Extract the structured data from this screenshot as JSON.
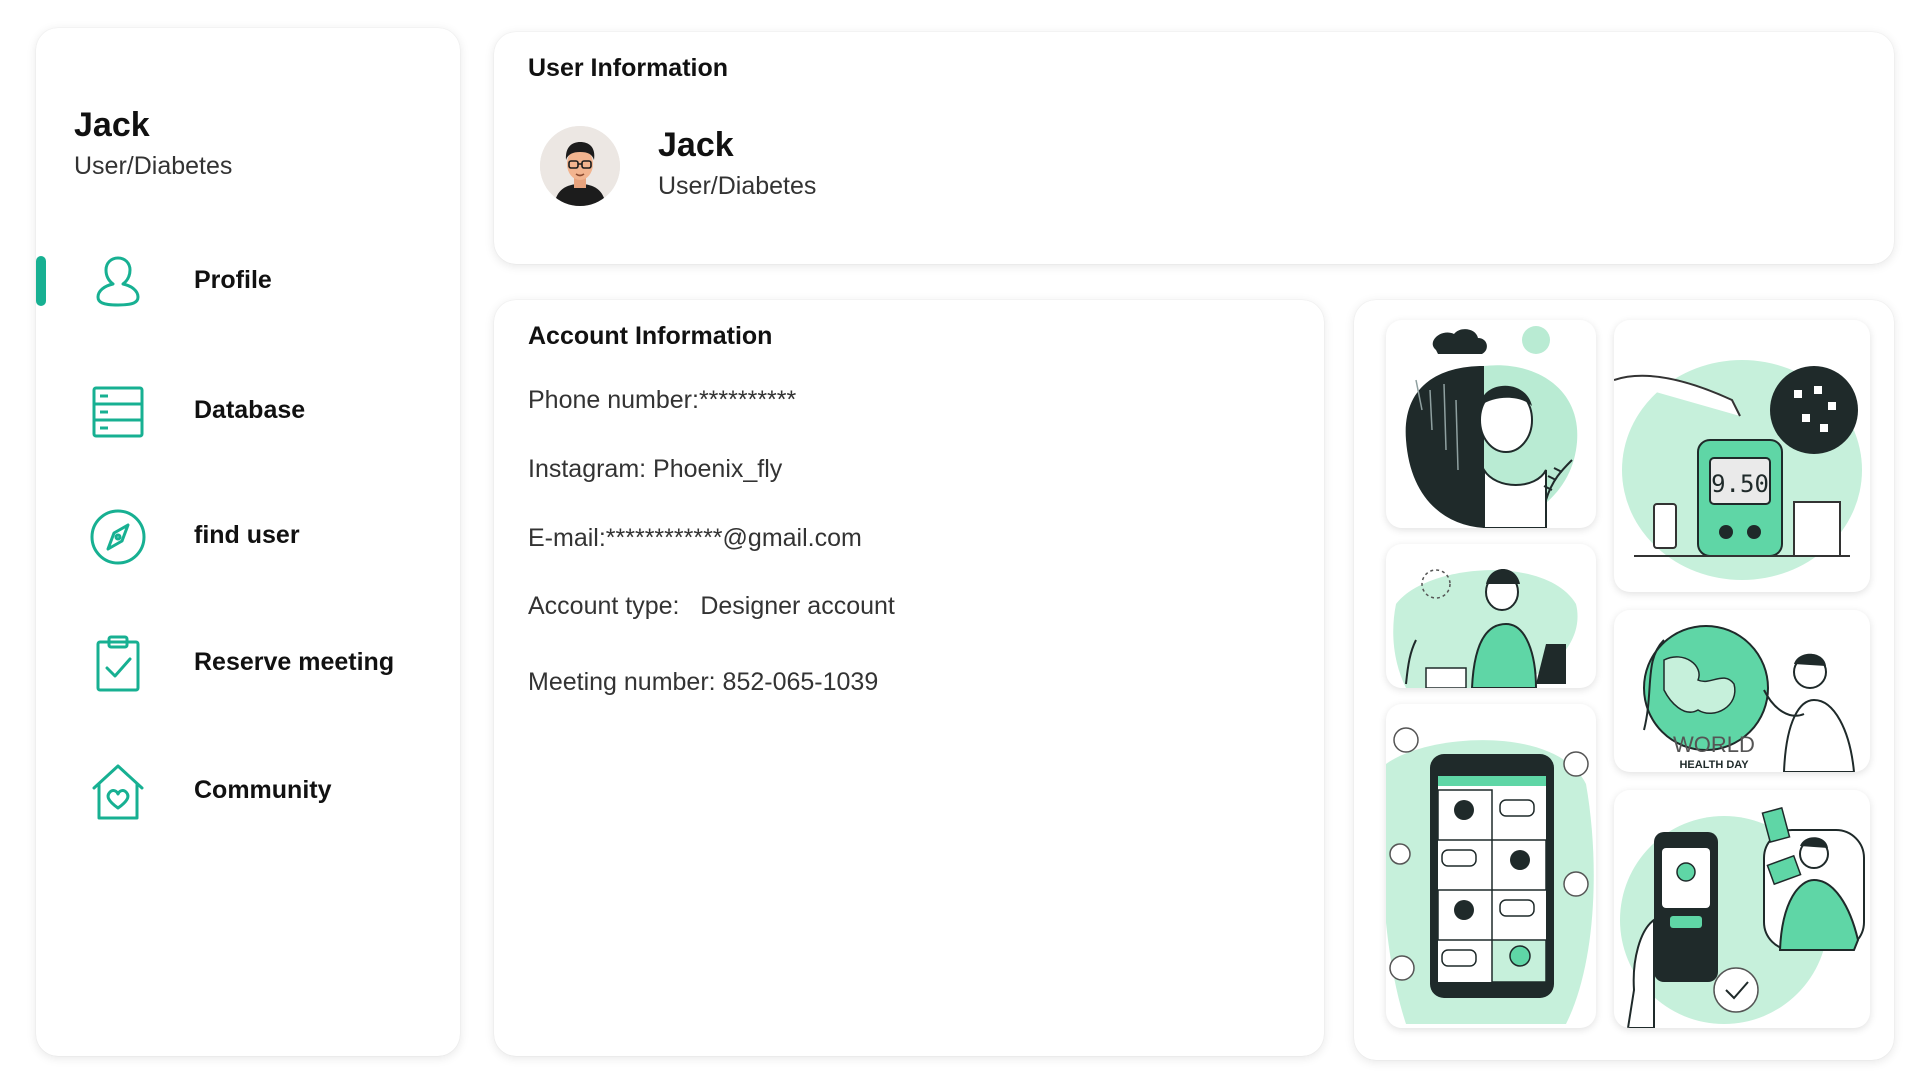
{
  "sidebar": {
    "user_name": "Jack",
    "user_role": "User/Diabetes",
    "active_item": "Profile",
    "accent_color": "#17b092",
    "items": [
      {
        "label": "Profile",
        "icon": "user-icon"
      },
      {
        "label": "Database",
        "icon": "database-icon"
      },
      {
        "label": "find user",
        "icon": "compass-icon"
      },
      {
        "label": "Reserve meeting",
        "icon": "clipboard-check-icon"
      },
      {
        "label": "Community",
        "icon": "house-heart-icon"
      }
    ]
  },
  "user_info": {
    "title": "User Information",
    "name": "Jack",
    "role": "User/Diabetes"
  },
  "account_info": {
    "title": "Account Information",
    "rows": [
      "Phone number:**********",
      "Instagram: Phoenix_fly",
      "E-mail:************@gmail.com",
      "Account type:   Designer account",
      "Meeting number: 852-065-1039"
    ]
  },
  "gallery": {
    "tiles": [
      {
        "icon": "mental-health-illustration"
      },
      {
        "icon": "glucose-meter-illustration",
        "text": "9.50"
      },
      {
        "icon": "lab-scientist-illustration"
      },
      {
        "icon": "world-health-day-illustration",
        "text": [
          "WORLD",
          "HEALTH DAY"
        ]
      },
      {
        "icon": "video-chat-illustration"
      },
      {
        "icon": "mobile-payment-illustration"
      }
    ]
  }
}
